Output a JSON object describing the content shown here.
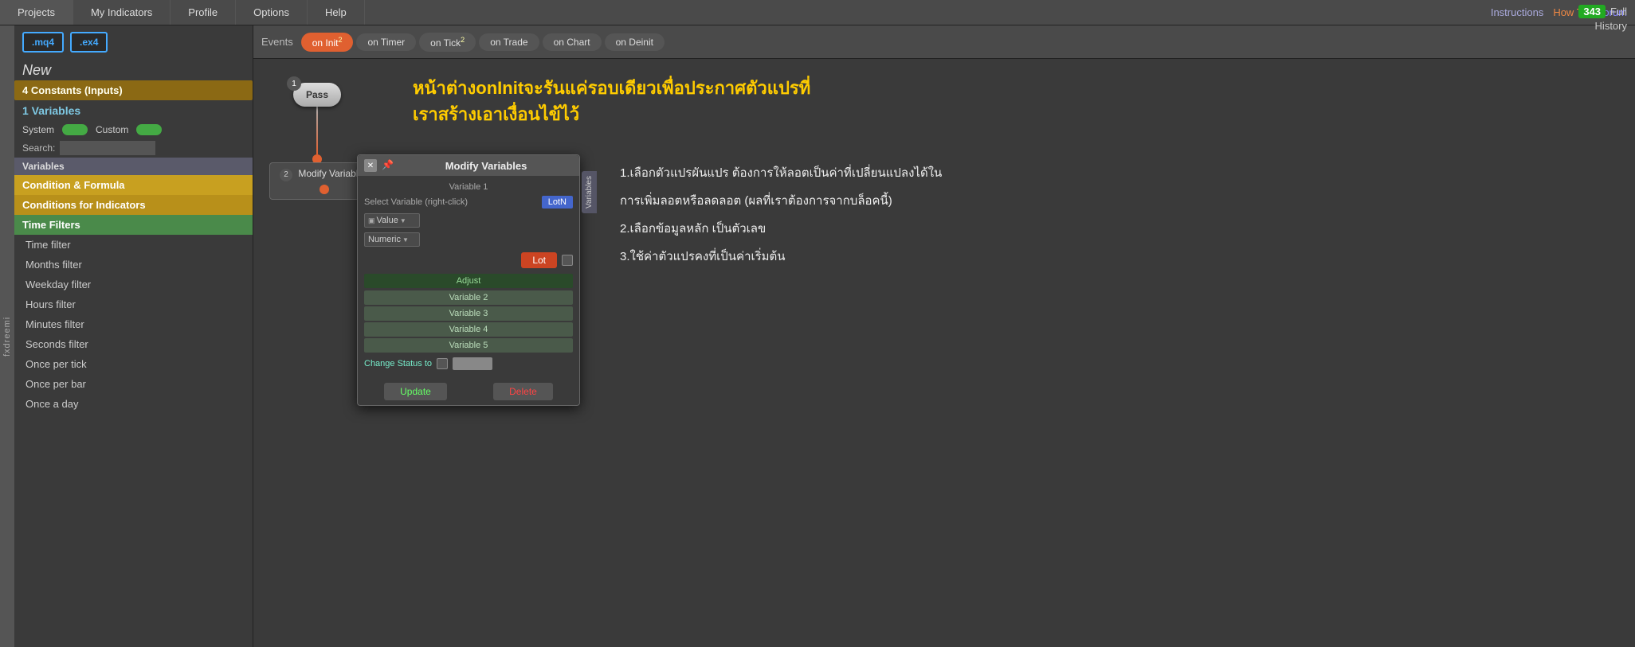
{
  "topnav": {
    "items": [
      "Projects",
      "My Indicators",
      "Profile",
      "Options",
      "Help"
    ],
    "links": {
      "instructions": "Instructions",
      "howto": "How To",
      "forum": "Forum"
    }
  },
  "sidebar_label": "fxdreemi",
  "left_panel": {
    "btn_mq4": ".mq4",
    "btn_ex4": ".ex4",
    "new_label": "New",
    "constants_label": "4 Constants (Inputs)",
    "variables_label": "1 Variables",
    "system_label": "System",
    "custom_label": "Custom",
    "search_label": "Search:",
    "search_placeholder": "",
    "group_variables": "Variables",
    "condition_formula": "Condition & Formula",
    "conditions_indicators": "Conditions for Indicators",
    "time_filters": "Time Filters",
    "items": [
      "Time filter",
      "Months filter",
      "Weekday filter",
      "Hours filter",
      "Minutes filter",
      "Seconds filter",
      "Once per tick",
      "Once per bar",
      "Once a day"
    ]
  },
  "events_bar": {
    "label": "Events",
    "on_init": "on Init",
    "on_init_badge": "2",
    "on_timer": "on Timer",
    "on_tick": "on Tick",
    "on_tick_badge": "2",
    "on_trade": "on Trade",
    "on_chart": "on Chart",
    "on_deinit": "on Deinit"
  },
  "top_right": {
    "count": "343",
    "full_label": "Full",
    "history_label": "History"
  },
  "pass_node": {
    "number": "1",
    "label": "Pass"
  },
  "modify_block": {
    "number": "2",
    "label": "Modify Variables"
  },
  "modal": {
    "title": "Modify Variables",
    "variable_label": "Variable 1",
    "select_variable_label": "Select Variable (right-click)",
    "lotn_btn": "LotN",
    "value_label": "Value",
    "numeric_label": "Numeric",
    "lot_btn": "Lot",
    "adjust_label": "Adjust",
    "variable_2": "Variable 2",
    "variable_3": "Variable 3",
    "variable_4": "Variable 4",
    "variable_5": "Variable 5",
    "change_status_label": "Change Status to",
    "update_btn": "Update",
    "delete_btn": "Delete",
    "side_tab": "Variables"
  },
  "instruction_thai": {
    "line1": "หน้าต่างonInitจะรันแค่รอบเดียวเพื่อประกาศตัวแปรที่",
    "line2": "เราสร้างเอาเงื่อนไข้ไว้"
  },
  "right_instructions": {
    "line1": "1.เลือกตัวแปรผันแปร ต้องการให้ลอตเป็นค่าที่เปลี่ยนแปลงได้ใน",
    "line1b": "การเพิ่มลอตหรือลดลอต (ผลที่เราต้องการจากบล็อคนี้)",
    "line2": "2.เลือกข้อมูลหลัก เป็นตัวเลข",
    "line3": "3.ใช้ค่าตัวแปรคงที่เป็นค่าเริ่มต้น"
  }
}
